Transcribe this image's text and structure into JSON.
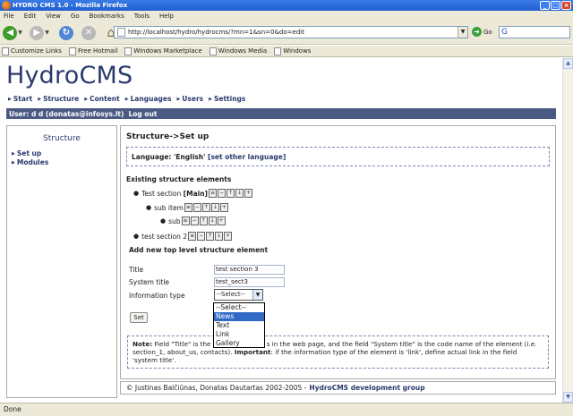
{
  "window": {
    "title": "HYDRO CMS 1.0 - Mozilla Firefox"
  },
  "menubar": [
    "File",
    "Edit",
    "View",
    "Go",
    "Bookmarks",
    "Tools",
    "Help"
  ],
  "nav": {
    "url": "http://localhost/hydro/hydrocms/?mn=1&sn=0&do=edit",
    "go_label": "Go"
  },
  "bookmarks": [
    "Customize Links",
    "Free Hotmail",
    "Windows Marketplace",
    "Windows Media",
    "Windows"
  ],
  "site": {
    "logo": "HydroCMS",
    "topnav": [
      "Start",
      "Structure",
      "Content",
      "Languages",
      "Users",
      "Settings"
    ],
    "user": "User: d d (donatas@infosys.lt)",
    "logout": "Log out"
  },
  "sidebar": {
    "title": "Structure",
    "items": [
      "Set up",
      "Modules"
    ]
  },
  "content": {
    "title": "Structure->Set up",
    "language_label": "Language: 'English'",
    "language_link": "[set other language]",
    "existing_heading": "Existing structure elements",
    "tree": [
      {
        "name": "Test section",
        "badge": "[Main]"
      },
      {
        "name": "sub item",
        "badge": ""
      },
      {
        "name": "sub",
        "badge": ""
      },
      {
        "name": "test section 2",
        "badge": ""
      }
    ],
    "add_heading": "Add new top level structure element",
    "form": {
      "title_label": "Title",
      "title_value": "test section 3",
      "system_title_label": "System title",
      "system_title_value": "test_sect3",
      "info_type_label": "Information type",
      "info_type_value": "--Select--",
      "set_button": "Set"
    },
    "dropdown_options": [
      "--Select--",
      "News",
      "Text",
      "Link",
      "Gallery"
    ],
    "dropdown_selected": "News",
    "note": {
      "label": "Note:",
      "text1": "Field \"Title\" is the",
      "text2": "s in the web page, and the field \"System title\" is the code name of the element (i.e. section_1, about_us, contacts).",
      "important": "Important",
      "text3": ": if the information type of the element is 'link', define actual link in the field 'system title'."
    }
  },
  "footer": {
    "copyright": "© Justinas Balčiūnas, Donatas Dautartas 2002-2005 -",
    "product": "HydroCMS development group"
  },
  "status": "Done"
}
